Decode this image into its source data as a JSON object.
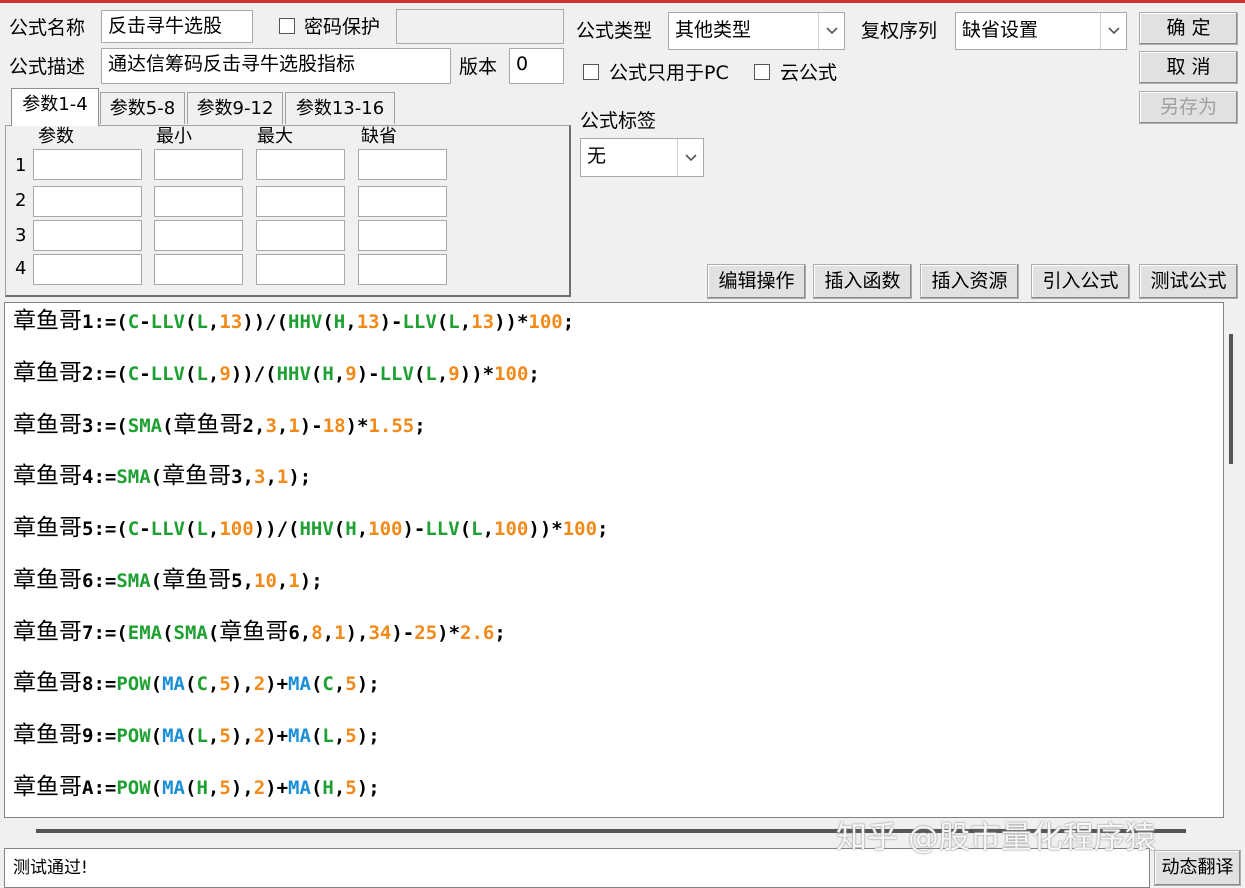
{
  "form": {
    "name_label": "公式名称",
    "name_value": "反击寻牛选股",
    "password_label": "密码保护",
    "password_value": "",
    "desc_label": "公式描述",
    "desc_value": "通达信筹码反击寻牛选股指标",
    "version_label": "版本",
    "version_value": "0",
    "type_label": "公式类型",
    "type_value": "其他类型",
    "adjust_label": "复权序列",
    "adjust_value": "缺省设置",
    "pc_only_label": "公式只用于PC",
    "cloud_label": "云公式",
    "tag_label": "公式标签",
    "tag_value": "无"
  },
  "buttons": {
    "ok": "确 定",
    "cancel": "取 消",
    "save_as": "另存为",
    "edit_ops": "编辑操作",
    "insert_func": "插入函数",
    "insert_res": "插入资源",
    "import_formula": "引入公式",
    "test_formula": "测试公式",
    "translate": "动态翻译"
  },
  "params": {
    "tabs": [
      "参数1-4",
      "参数5-8",
      "参数9-12",
      "参数13-16"
    ],
    "headers": [
      "参数",
      "最小",
      "最大",
      "缺省"
    ],
    "rows": [
      "1",
      "2",
      "3",
      "4"
    ]
  },
  "code_lines": [
    [
      [
        "章鱼哥",
        "pre"
      ],
      [
        "1:=(",
        "k"
      ],
      [
        "C",
        "g"
      ],
      [
        "-",
        "k"
      ],
      [
        "LLV",
        "g"
      ],
      [
        "(",
        "k"
      ],
      [
        "L",
        "g"
      ],
      [
        ",",
        "k"
      ],
      [
        "13",
        "o"
      ],
      [
        "))/(",
        "k"
      ],
      [
        "HHV",
        "g"
      ],
      [
        "(",
        "k"
      ],
      [
        "H",
        "g"
      ],
      [
        ",",
        "k"
      ],
      [
        "13",
        "o"
      ],
      [
        ")-",
        "k"
      ],
      [
        "LLV",
        "g"
      ],
      [
        "(",
        "k"
      ],
      [
        "L",
        "g"
      ],
      [
        ",",
        "k"
      ],
      [
        "13",
        "o"
      ],
      [
        "))*",
        "k"
      ],
      [
        "100",
        "o"
      ],
      [
        ";",
        "k"
      ]
    ],
    [
      [
        "章鱼哥",
        "pre"
      ],
      [
        "2:=(",
        "k"
      ],
      [
        "C",
        "g"
      ],
      [
        "-",
        "k"
      ],
      [
        "LLV",
        "g"
      ],
      [
        "(",
        "k"
      ],
      [
        "L",
        "g"
      ],
      [
        ",",
        "k"
      ],
      [
        "9",
        "o"
      ],
      [
        "))/(",
        "k"
      ],
      [
        "HHV",
        "g"
      ],
      [
        "(",
        "k"
      ],
      [
        "H",
        "g"
      ],
      [
        ",",
        "k"
      ],
      [
        "9",
        "o"
      ],
      [
        ")-",
        "k"
      ],
      [
        "LLV",
        "g"
      ],
      [
        "(",
        "k"
      ],
      [
        "L",
        "g"
      ],
      [
        ",",
        "k"
      ],
      [
        "9",
        "o"
      ],
      [
        "))*",
        "k"
      ],
      [
        "100",
        "o"
      ],
      [
        ";",
        "k"
      ]
    ],
    [
      [
        "章鱼哥",
        "pre"
      ],
      [
        "3:=(",
        "k"
      ],
      [
        "SMA",
        "g"
      ],
      [
        "(",
        "k"
      ],
      [
        "章鱼哥",
        "pre"
      ],
      [
        "2,",
        "k"
      ],
      [
        "3",
        "o"
      ],
      [
        ",",
        "k"
      ],
      [
        "1",
        "o"
      ],
      [
        ")-",
        "k"
      ],
      [
        "18",
        "o"
      ],
      [
        ")*",
        "k"
      ],
      [
        "1.55",
        "o"
      ],
      [
        ";",
        "k"
      ]
    ],
    [
      [
        "章鱼哥",
        "pre"
      ],
      [
        "4:=",
        "k"
      ],
      [
        "SMA",
        "g"
      ],
      [
        "(",
        "k"
      ],
      [
        "章鱼哥",
        "pre"
      ],
      [
        "3,",
        "k"
      ],
      [
        "3",
        "o"
      ],
      [
        ",",
        "k"
      ],
      [
        "1",
        "o"
      ],
      [
        ");",
        "k"
      ]
    ],
    [
      [
        "章鱼哥",
        "pre"
      ],
      [
        "5:=(",
        "k"
      ],
      [
        "C",
        "g"
      ],
      [
        "-",
        "k"
      ],
      [
        "LLV",
        "g"
      ],
      [
        "(",
        "k"
      ],
      [
        "L",
        "g"
      ],
      [
        ",",
        "k"
      ],
      [
        "100",
        "o"
      ],
      [
        "))/(",
        "k"
      ],
      [
        "HHV",
        "g"
      ],
      [
        "(",
        "k"
      ],
      [
        "H",
        "g"
      ],
      [
        ",",
        "k"
      ],
      [
        "100",
        "o"
      ],
      [
        ")-",
        "k"
      ],
      [
        "LLV",
        "g"
      ],
      [
        "(",
        "k"
      ],
      [
        "L",
        "g"
      ],
      [
        ",",
        "k"
      ],
      [
        "100",
        "o"
      ],
      [
        "))*",
        "k"
      ],
      [
        "100",
        "o"
      ],
      [
        ";",
        "k"
      ]
    ],
    [
      [
        "章鱼哥",
        "pre"
      ],
      [
        "6:=",
        "k"
      ],
      [
        "SMA",
        "g"
      ],
      [
        "(",
        "k"
      ],
      [
        "章鱼哥",
        "pre"
      ],
      [
        "5,",
        "k"
      ],
      [
        "10",
        "o"
      ],
      [
        ",",
        "k"
      ],
      [
        "1",
        "o"
      ],
      [
        ");",
        "k"
      ]
    ],
    [
      [
        "章鱼哥",
        "pre"
      ],
      [
        "7:=(",
        "k"
      ],
      [
        "EMA",
        "g"
      ],
      [
        "(",
        "k"
      ],
      [
        "SMA",
        "g"
      ],
      [
        "(",
        "k"
      ],
      [
        "章鱼哥",
        "pre"
      ],
      [
        "6,",
        "k"
      ],
      [
        "8",
        "o"
      ],
      [
        ",",
        "k"
      ],
      [
        "1",
        "o"
      ],
      [
        "),",
        "k"
      ],
      [
        "34",
        "o"
      ],
      [
        ")-",
        "k"
      ],
      [
        "25",
        "o"
      ],
      [
        ")*",
        "k"
      ],
      [
        "2.6",
        "o"
      ],
      [
        ";",
        "k"
      ]
    ],
    [
      [
        "章鱼哥",
        "pre"
      ],
      [
        "8:=",
        "k"
      ],
      [
        "POW",
        "g"
      ],
      [
        "(",
        "k"
      ],
      [
        "MA",
        "b"
      ],
      [
        "(",
        "k"
      ],
      [
        "C",
        "g"
      ],
      [
        ",",
        "k"
      ],
      [
        "5",
        "o"
      ],
      [
        "),",
        "k"
      ],
      [
        "2",
        "o"
      ],
      [
        ")+",
        "k"
      ],
      [
        "MA",
        "b"
      ],
      [
        "(",
        "k"
      ],
      [
        "C",
        "g"
      ],
      [
        ",",
        "k"
      ],
      [
        "5",
        "o"
      ],
      [
        ");",
        "k"
      ]
    ],
    [
      [
        "章鱼哥",
        "pre"
      ],
      [
        "9:=",
        "k"
      ],
      [
        "POW",
        "g"
      ],
      [
        "(",
        "k"
      ],
      [
        "MA",
        "b"
      ],
      [
        "(",
        "k"
      ],
      [
        "L",
        "g"
      ],
      [
        ",",
        "k"
      ],
      [
        "5",
        "o"
      ],
      [
        "),",
        "k"
      ],
      [
        "2",
        "o"
      ],
      [
        ")+",
        "k"
      ],
      [
        "MA",
        "b"
      ],
      [
        "(",
        "k"
      ],
      [
        "L",
        "g"
      ],
      [
        ",",
        "k"
      ],
      [
        "5",
        "o"
      ],
      [
        ");",
        "k"
      ]
    ],
    [
      [
        "章鱼哥",
        "pre"
      ],
      [
        "A:=",
        "k"
      ],
      [
        "POW",
        "g"
      ],
      [
        "(",
        "k"
      ],
      [
        "MA",
        "b"
      ],
      [
        "(",
        "k"
      ],
      [
        "H",
        "g"
      ],
      [
        ",",
        "k"
      ],
      [
        "5",
        "o"
      ],
      [
        "),",
        "k"
      ],
      [
        "2",
        "o"
      ],
      [
        ")+",
        "k"
      ],
      [
        "MA",
        "b"
      ],
      [
        "(",
        "k"
      ],
      [
        "H",
        "g"
      ],
      [
        ",",
        "k"
      ],
      [
        "5",
        "o"
      ],
      [
        ");",
        "k"
      ]
    ]
  ],
  "status": {
    "message": "测试通过!"
  },
  "watermark": "知乎 @股市量化程序猿",
  "colors": {
    "keyword_green": "#1fa032",
    "number_orange": "#f28a1a",
    "ma_blue": "#1a8fd8"
  }
}
